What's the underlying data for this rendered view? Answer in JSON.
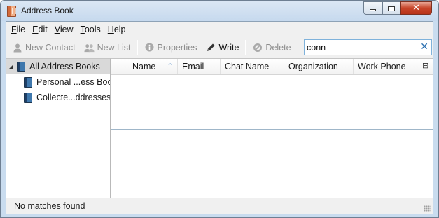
{
  "window": {
    "title": "Address Book",
    "close_glyph": "✕"
  },
  "menu": {
    "items": [
      {
        "key": "F",
        "rest": "ile"
      },
      {
        "key": "E",
        "rest": "dit"
      },
      {
        "key": "V",
        "rest": "iew"
      },
      {
        "key": "T",
        "rest": "ools"
      },
      {
        "key": "H",
        "rest": "elp"
      }
    ]
  },
  "toolbar": {
    "new_contact": "New Contact",
    "new_list": "New List",
    "properties": "Properties",
    "write": "Write",
    "delete": "Delete",
    "icons": [
      "contact-icon",
      "list-icon",
      "info-icon",
      "pencil-icon",
      "delete-icon"
    ]
  },
  "search": {
    "value": "conn",
    "clear_glyph": "✕"
  },
  "tree": {
    "root": "All Address Books",
    "expander": "◢",
    "books": [
      "Personal ...ess Book",
      "Collecte...ddresses"
    ]
  },
  "columns": {
    "headers": [
      "Name",
      "Email",
      "Chat Name",
      "Organization",
      "Work Phone"
    ],
    "sort_indicator": "^",
    "sorted_column": "Name",
    "picker_glyph": "⊟"
  },
  "status": {
    "text": "No matches found"
  },
  "colors": {
    "title_bg": "#c9dcef",
    "close_button": "#c7452a",
    "search_border": "#7fb2db",
    "selected_row": "#d9d9d9"
  }
}
